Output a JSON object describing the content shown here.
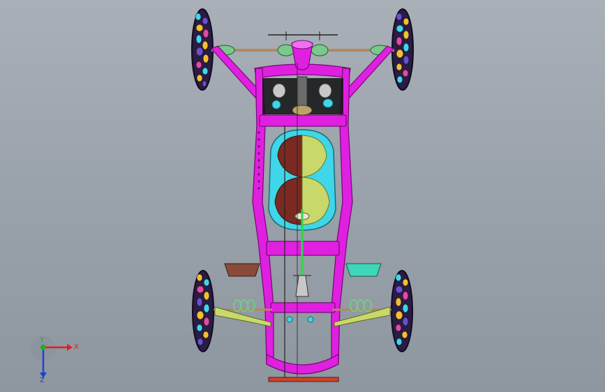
{
  "viewport": {
    "background_top": "#a9b0b8",
    "background_bottom": "#8e969f"
  },
  "model": {
    "frame_color": "#e020e0",
    "frame_edge": "#7a0a7a",
    "tire_color": "#2b1c44",
    "seat_left_color": "#7a2a22",
    "seat_right_color": "#c9d86a",
    "seat_rim_color": "#3ed6e8",
    "axle_color": "#b08a5a",
    "spring_color": "#79c98a",
    "shaft_color": "#2fd64a",
    "pedal_left_color": "#8a4a3a",
    "pedal_right_color": "#3ed6b8"
  },
  "triad": {
    "x_label": "X",
    "y_label": "Y",
    "z_label": "Z",
    "x_color": "#e02020",
    "y_color": "#20b020",
    "z_color": "#2040d0"
  }
}
